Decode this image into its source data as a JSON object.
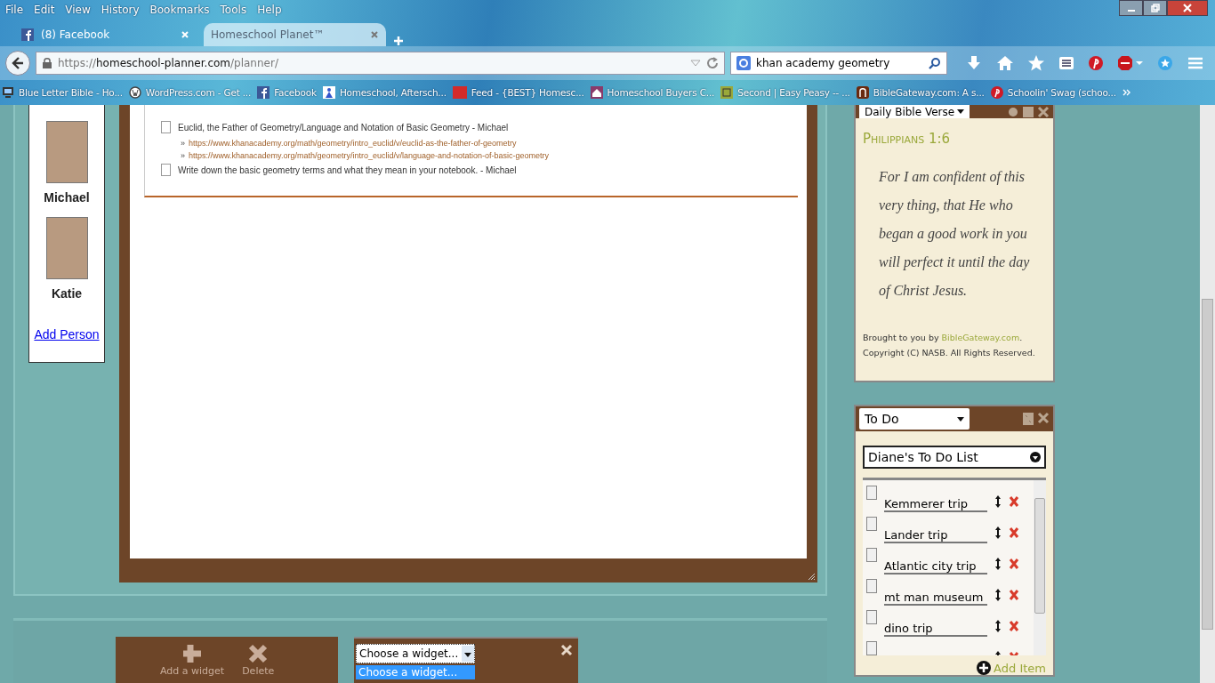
{
  "menu_bar": [
    "File",
    "Edit",
    "View",
    "History",
    "Bookmarks",
    "Tools",
    "Help"
  ],
  "tabs": [
    {
      "title": "(8) Facebook",
      "selected": false,
      "kind": "facebook"
    },
    {
      "title": "Homeschool Planet™",
      "selected": true,
      "kind": "plain"
    }
  ],
  "address_bar": {
    "scheme": "https://",
    "host": "homeschool-planner.com",
    "path": "/planner/"
  },
  "search_bar": {
    "value": "khan academy geometry"
  },
  "bookmarks": [
    {
      "label": "Blue Letter Bible - Ho...",
      "kind": "monitor"
    },
    {
      "label": "WordPress.com - Get ...",
      "kind": "wordpress"
    },
    {
      "label": "Facebook",
      "kind": "facebook"
    },
    {
      "label": "Homeschool, Aftersch...",
      "kind": "figure"
    },
    {
      "label": "Feed - {BEST} Homesc...",
      "kind": "vs"
    },
    {
      "label": "Homeschool Buyers C...",
      "kind": "house"
    },
    {
      "label": "Second | Easy Peasy -- ...",
      "kind": "ep"
    },
    {
      "label": "BibleGateway.com: A s...",
      "kind": "book"
    },
    {
      "label": "Schoolin' Swag (schoo...",
      "kind": "pinterest"
    }
  ],
  "people": [
    {
      "name": "Michael"
    },
    {
      "name": "Katie"
    }
  ],
  "add_person": "Add Person",
  "tasks": [
    {
      "text": "Euclid, the Father of Geometry/Language and Notation of Basic Geometry - Michael",
      "checked": false,
      "links": [
        {
          "marker": "»",
          "url": "https://www.khanacademy.org/math/geometry/intro_euclid/v/euclid-as-the-father-of-geometry"
        },
        {
          "marker": "»",
          "url": "https://www.khanacademy.org/math/geometry/intro_euclid/v/language-and-notation-of-basic-geometry"
        }
      ]
    },
    {
      "text": "Write down the basic geometry terms and what they mean in your notebook. - Michael",
      "checked": false
    }
  ],
  "verse_widget": {
    "select": "Daily Bible Verse",
    "reference": "Philippians 1:6",
    "verse": "For I am confident of this very thing, that He who began a good work in you will perfect it until the day of Christ Jesus.",
    "credit_before": "Brought to you by ",
    "credit_link": "BibleGateway.com",
    "credit_after": ". Copyright (C) NASB. All Rights Reserved."
  },
  "todo_widget": {
    "select": "To Do",
    "list": "Diane's To Do List",
    "items": [
      {
        "text": "Kemmerer trip",
        "checked": false
      },
      {
        "text": "Lander trip",
        "checked": false
      },
      {
        "text": "Atlantic city trip",
        "checked": false
      },
      {
        "text": "mt man museum",
        "checked": false
      },
      {
        "text": "dino trip",
        "checked": false
      },
      {
        "checked": false
      }
    ],
    "add_item": "Add Item"
  },
  "widget_toolbar": [
    "Add a widget",
    "Delete"
  ],
  "widget_chooser": {
    "value": "Choose a widget...",
    "options": [
      {
        "label": "Choose a widget...",
        "selected": true
      }
    ]
  }
}
